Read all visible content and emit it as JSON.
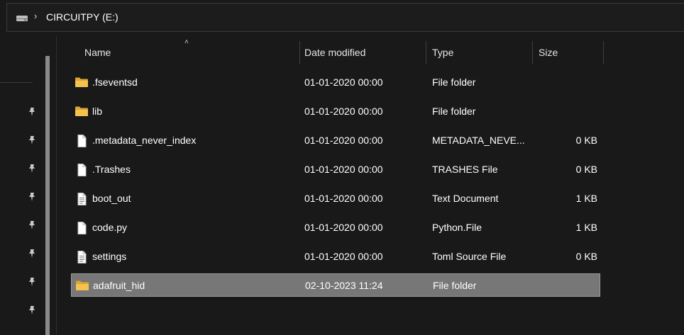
{
  "address": {
    "drive_icon": "drive-icon",
    "path": "CIRCUITPY (E:)"
  },
  "columns": {
    "name": "Name",
    "date": "Date modified",
    "type": "Type",
    "size": "Size"
  },
  "files": [
    {
      "name": ".fseventsd",
      "date": "01-01-2020 00:00",
      "type": "File folder",
      "size": "",
      "icon": "folder-icon"
    },
    {
      "name": "lib",
      "date": "01-01-2020 00:00",
      "type": "File folder",
      "size": "",
      "icon": "folder-icon"
    },
    {
      "name": ".metadata_never_index",
      "date": "01-01-2020 00:00",
      "type": "METADATA_NEVE...",
      "size": "0 KB",
      "icon": "file-icon"
    },
    {
      "name": ".Trashes",
      "date": "01-01-2020 00:00",
      "type": "TRASHES File",
      "size": "0 KB",
      "icon": "file-icon"
    },
    {
      "name": "boot_out",
      "date": "01-01-2020 00:00",
      "type": "Text Document",
      "size": "1 KB",
      "icon": "text-document-icon"
    },
    {
      "name": "code.py",
      "date": "01-01-2020 00:00",
      "type": "Python.File",
      "size": "1 KB",
      "icon": "file-icon"
    },
    {
      "name": "settings",
      "date": "01-01-2020 00:00",
      "type": "Toml Source File",
      "size": "0 KB",
      "icon": "text-document-icon"
    },
    {
      "name": "adafruit_hid",
      "date": "02-10-2023 11:24",
      "type": "File folder",
      "size": "",
      "icon": "folder-icon",
      "selected": true
    }
  ],
  "colors": {
    "background": "#191919",
    "selected_row": "#777777",
    "folder": "#f3c24f"
  }
}
